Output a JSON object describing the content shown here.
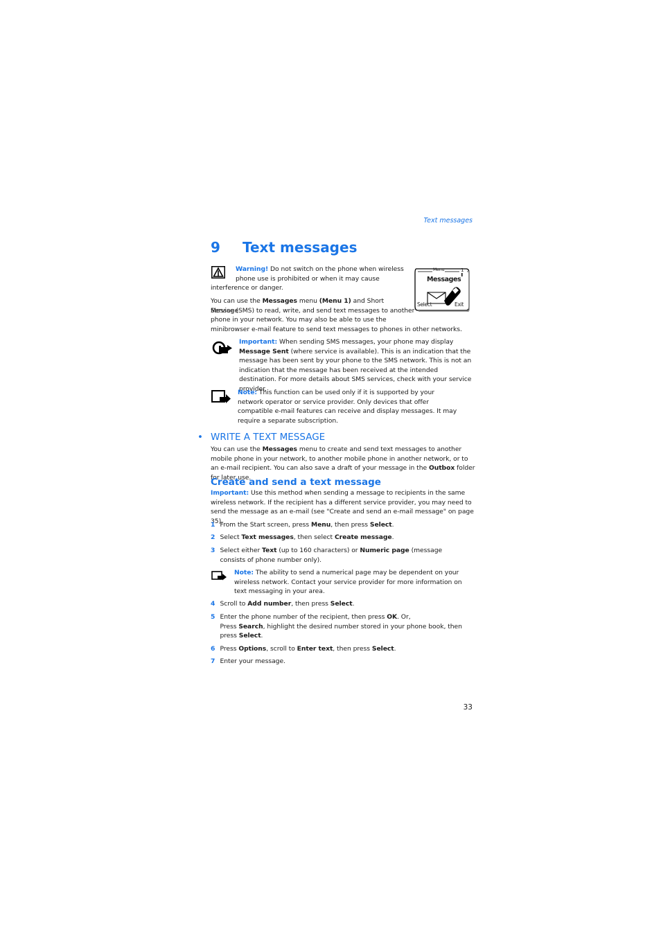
{
  "running_head": "Text messages",
  "chapter": {
    "number": "9",
    "title": "Text messages"
  },
  "warning": {
    "label": "Warning!",
    "text_line1": " Do not switch on the phone when wireless",
    "text_line2": "phone use is prohibited or when it may cause",
    "text_line3": "interference or danger."
  },
  "phone_screen": {
    "header": "Menu",
    "index": "1",
    "title": "Messages",
    "left_softkey": "Select",
    "right_softkey": "Exit"
  },
  "intro": {
    "p1": "You can use the ",
    "b1": "Messages",
    "p2": " menu ",
    "b2": "(Menu 1)",
    "p3": " and Short Message",
    "line2": "Service (SMS) to read, write, and send text messages to another",
    "line3": "phone in your network. You may also be able to use the",
    "line4": "minibrowser e-mail feature to send text messages to phones in other networks."
  },
  "important1": {
    "label": "Important:",
    "p1": " When sending SMS messages, your phone may display ",
    "b1": "Message Sent",
    "p2": " (where service is available). This is an indication that the message has been sent by your phone to the SMS network. This is not an indication that the message has been received at the intended destination. For more details about SMS services, check with your service provider."
  },
  "note1": {
    "label": "Note:",
    "text": " This function can be used only if it is supported by your network operator or service provider. Only devices that offer compatible e-mail features can receive and display messages. It may require a separate subscription."
  },
  "section": {
    "bullet": "•",
    "title": "WRITE A TEXT MESSAGE",
    "p1": "You can use the ",
    "b1": "Messages",
    "p2": " menu to create and send text messages to another mobile phone in your network, to another mobile phone in another network, or to an e-mail recipient. You can also save a draft of your message in the ",
    "b2": "Outbox",
    "p3": " folder for later use."
  },
  "subsection": {
    "title": "Create and send a text message",
    "important_label": "Important:",
    "important_text": " Use this method when sending a message to recipients in the same wireless network. If the recipient has a different service provider, you may need to send the message as an e-mail (see \"Create and send an e-mail message\" on page 35)."
  },
  "steps": [
    {
      "n": "1",
      "a": "From the Start screen, press ",
      "b": "Menu",
      "c": ", then press ",
      "d": "Select",
      "e": "."
    },
    {
      "n": "2",
      "a": "Select ",
      "b": "Text messages",
      "c": ", then select ",
      "d": "Create message",
      "e": "."
    },
    {
      "n": "3",
      "a": "Select either ",
      "b": "Text",
      "c": " (up to 160 characters) or ",
      "d": "Numeric page",
      "e": " (message consists of phone number only)."
    },
    {
      "n": "4",
      "a": "Scroll to ",
      "b": "Add number",
      "c": ", then press ",
      "d": "Select",
      "e": "."
    },
    {
      "n": "5",
      "a": "Enter the phone number of the recipient, then press ",
      "b": "OK",
      "c": ". Or,",
      "line2a": "Press ",
      "line2b": "Search",
      "line2c": ", highlight the desired number stored in your phone book, then press ",
      "line2d": "Select",
      "line2e": "."
    },
    {
      "n": "6",
      "a": "Press ",
      "b": "Options",
      "c": ", scroll to ",
      "d": "Enter text",
      "e": ", then press ",
      "f": "Select",
      "g": "."
    },
    {
      "n": "7",
      "a": "Enter your message."
    }
  ],
  "note2": {
    "label": "Note:",
    "text": " The ability to send a numerical page may be dependent on your wireless network. Contact your service provider for more information on text messaging in your area."
  },
  "page_number": "33"
}
